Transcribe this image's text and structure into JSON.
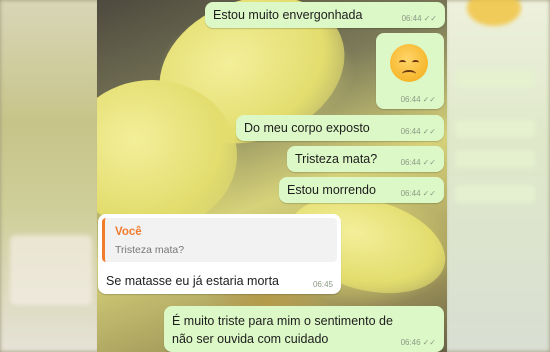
{
  "messages": [
    {
      "id": "m1",
      "direction": "outgoing",
      "text": "Estou muito envergonhada",
      "time": "06:44",
      "status_icon": "double-check-icon"
    },
    {
      "id": "m2",
      "direction": "outgoing",
      "emoji": "disappointed-face-emoji",
      "time": "06:44",
      "status_icon": "double-check-icon"
    },
    {
      "id": "m3",
      "direction": "outgoing",
      "text": "Do meu corpo exposto",
      "time": "06:44",
      "status_icon": "double-check-icon"
    },
    {
      "id": "m4",
      "direction": "outgoing",
      "text": "Tristeza mata?",
      "time": "06:44",
      "status_icon": "double-check-icon"
    },
    {
      "id": "m5",
      "direction": "outgoing",
      "text": "Estou morrendo",
      "time": "06:44",
      "status_icon": "double-check-icon"
    },
    {
      "id": "m6",
      "direction": "incoming",
      "quote": {
        "author": "Você",
        "text": "Tristeza mata?"
      },
      "text": "Se matasse eu já estaria morta",
      "time": "06:45"
    },
    {
      "id": "m7",
      "direction": "outgoing",
      "lines": [
        "É muito triste para mim o sentimento de",
        "não ser ouvida com cuidado"
      ],
      "time": "06:46",
      "status_icon": "double-check-icon"
    }
  ],
  "colors": {
    "outgoing_bubble": "#dcf8c6",
    "incoming_bubble": "#ffffff",
    "quote_accent": "#f07c2e"
  }
}
